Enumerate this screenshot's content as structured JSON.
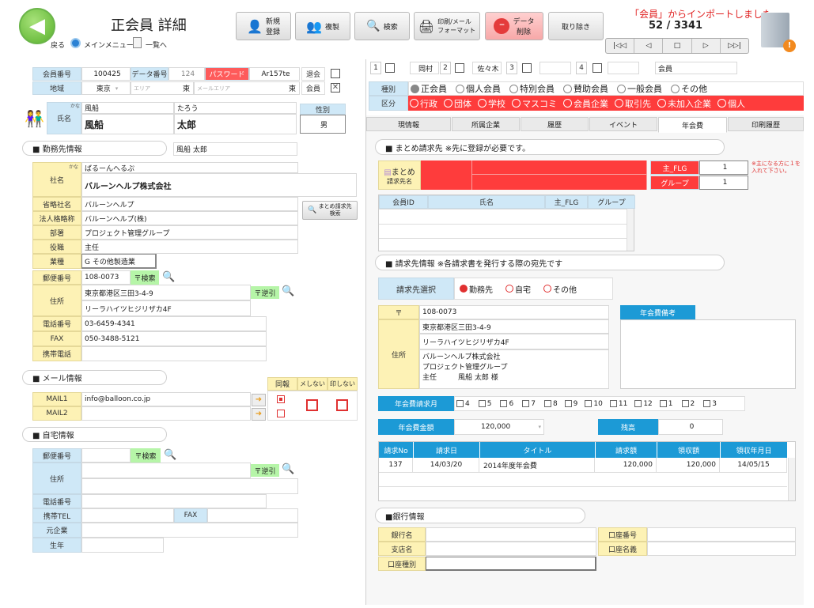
{
  "header": {
    "title": "正会員 詳細",
    "back_label": "戻る",
    "main_menu_label": "メインメニュー",
    "list_label": "一覧へ",
    "import_msg": "「会員」からインポートしました",
    "record_counter": "52 / 3341"
  },
  "toolbar": {
    "new_label": "新規\n登録",
    "copy_label": "複製",
    "search_label": "検索",
    "print_label": "印刷/メール\nフォーマット",
    "delete_label": "データ\n削除",
    "cancel_label": "取り除き"
  },
  "member": {
    "no_label": "会員番号",
    "no": "100425",
    "data_no_label": "データ番号",
    "data_no": "124",
    "password_label": "パスワード",
    "password": "Ar157te",
    "withdraw_label": "退会",
    "member_label": "会員",
    "region_label": "地域",
    "region": "東京",
    "area_label": "エリア",
    "area": "東",
    "mail_area_label": "メールエリア",
    "mail_area": "東",
    "name_label": "氏名",
    "kana_label": "かな",
    "kana_last": "風船",
    "kana_first": "たろう",
    "last_name": "風船",
    "first_name": "太郎",
    "gender_label": "性別",
    "gender": "男"
  },
  "work": {
    "section": "■ 勤務先情報",
    "contact": "風船 太郎",
    "company_label": "社名",
    "company_kana": "ばるーんへるぷ",
    "company": "バルーンヘルプ株式会社",
    "short_label": "省略社名",
    "short": "バルーンヘルプ",
    "corp_label": "法人格略称",
    "corp": "バルーンヘルプ(株)",
    "dept_label": "部署",
    "dept": "プロジェクト管理グループ",
    "title_label": "役職",
    "title": "主任",
    "industry_label": "業種",
    "industry": "G  その他製造業",
    "zip_label": "郵便番号",
    "zip": "108-0073",
    "zip_search": "〒検索",
    "reverse": "〒逆引",
    "addr_label": "住所",
    "addr1": "東京都港区三田3-4-9",
    "addr2": "リーラハイツヒジリザカ4F",
    "tel_label": "電話番号",
    "tel": "03-6459-4341",
    "fax_label": "FAX",
    "fax": "050-3488-5121",
    "mobile_label": "携帯電話",
    "bulk_btn": "まとめ請求先\n検索"
  },
  "mail": {
    "section": "■ メール情報",
    "same_label": "同報",
    "nomail_label": "メしない",
    "noprint_label": "印しない",
    "mail1_label": "MAIL1",
    "mail1": "info@balloon.co.jp",
    "mail2_label": "MAIL2"
  },
  "home": {
    "section": "■ 自宅情報",
    "zip_label": "郵便番号",
    "zip_search": "〒検索",
    "reverse": "〒逆引",
    "addr_label": "住所",
    "tel_label": "電話番号",
    "mobile_label": "携帯TEL",
    "fax_label": "FAX",
    "former_label": "元企業",
    "birth_label": "生年"
  },
  "groups": {
    "n1": "1",
    "v1": "岡村",
    "n2": "2",
    "v2": "佐々木",
    "n3": "3",
    "v3": "",
    "n4": "4",
    "v4": "",
    "member_text": "会員"
  },
  "kind": {
    "label": "種別",
    "options": [
      "正会員",
      "個人会員",
      "特別会員",
      "賛助会員",
      "一般会員",
      "その他"
    ],
    "division_label": "区分",
    "divisions": [
      "行政",
      "団体",
      "学校",
      "マスコミ",
      "会員企業",
      "取引先",
      "未加入企業",
      "個人"
    ]
  },
  "tabs": [
    "現情報",
    "所属企業",
    "履歴",
    "イベント",
    "年会費",
    "印刷履歴"
  ],
  "bulk": {
    "section": "■ まとめ請求先  ※先に登録が必要です。",
    "name_label1": "まとめ",
    "name_label2": "請求先名",
    "main_flg_label": "主_FLG",
    "main_flg": "1",
    "group_label": "グループ",
    "group": "1",
    "note": "※主になる方に１を入れて下さい。",
    "cols": [
      "会員ID",
      "氏名",
      "主_FLG",
      "グループ"
    ]
  },
  "billing": {
    "section": "■ 請求先情報   ※各請求書を発行する際の宛先です",
    "select_label": "請求先選択",
    "options": [
      "勤務先",
      "自宅",
      "その他"
    ],
    "zip_label": "〒",
    "zip": "108-0073",
    "addr_label": "住所",
    "addr1": "東京都港区三田3-4-9",
    "addr2": "リーラハイツヒジリザカ4F",
    "addr3": "バルーンヘルプ株式会社",
    "addr4": "プロジェクト管理グループ",
    "addr5": "主任　　　風船 太郎 様",
    "note_label": "年会費備考"
  },
  "fee": {
    "months_label": "年会費請求月",
    "months": [
      "4",
      "5",
      "6",
      "7",
      "8",
      "9",
      "10",
      "11",
      "12",
      "1",
      "2",
      "3"
    ],
    "amount_label": "年会費金額",
    "amount": "120,000",
    "balance_label": "残高",
    "balance": "0",
    "cols": [
      "請求No",
      "請求日",
      "タイトル",
      "請求額",
      "領収額",
      "領収年月日"
    ],
    "row": [
      "137",
      "14/03/20",
      "2014年度年会費",
      "120,000",
      "120,000",
      "14/05/15"
    ]
  },
  "bank": {
    "section": "■銀行情報",
    "bank_label": "銀行名",
    "branch_label": "支店名",
    "type_label": "口座種別",
    "acct_no_label": "口座番号",
    "acct_name_label": "口座名義"
  },
  "colors": {
    "accent_red": "#fe3c3c",
    "label_blue": "#cfe8f7",
    "label_yellow": "#fdf2b5",
    "tab_blue": "#1c9ad6",
    "green": "#b6f5a8"
  }
}
